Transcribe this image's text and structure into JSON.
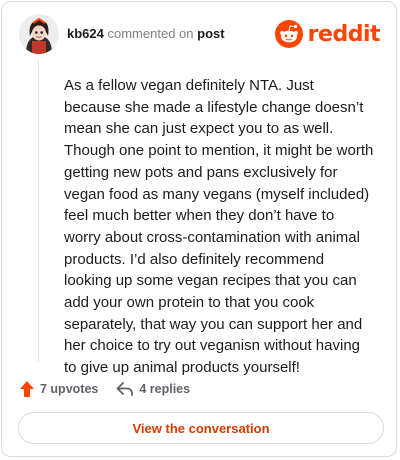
{
  "header": {
    "username": "kb624",
    "action_text": "commented on",
    "post_link": "post",
    "brand_wordmark": "reddit"
  },
  "comment": {
    "body": "As a fellow vegan definitely NTA. Just because she made a lifestyle change doesn’t mean she can just expect you to as well. Though one point to mention, it might be worth getting new pots and pans exclusively for vegan food as many vegans (myself included) feel much better when they don’t have to worry about cross-contamination with animal products. I’d also definitely recommend looking up some vegan recipes that you can add your own protein to that you cook separately, that way you can support her and her choice to try out veganisn without having to give up animal products yourself!"
  },
  "actions": {
    "upvotes_label": "7 upvotes",
    "replies_label": "4 replies"
  },
  "footer": {
    "view_button_label": "View the conversation"
  },
  "icons": {
    "upvote": "upvote-arrow-icon",
    "reply": "reply-arrow-icon",
    "logo": "reddit-snoo-icon"
  },
  "colors": {
    "brand": "#ff4500",
    "link_accent": "#d93a00",
    "text": "#1c1c1c",
    "muted": "#7c7f83"
  }
}
